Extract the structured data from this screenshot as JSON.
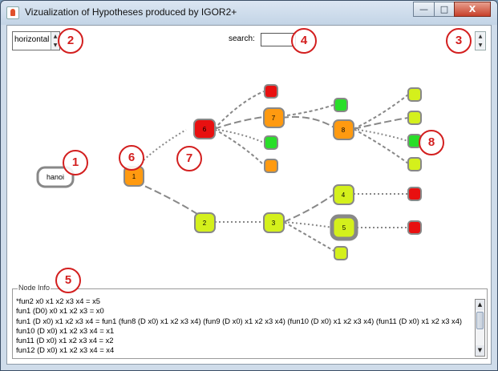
{
  "window": {
    "title": "Vizualization of Hypotheses produced by IGOR2+",
    "buttons": {
      "minimize": "—",
      "maximize": "□",
      "close": "X"
    }
  },
  "controls": {
    "orientation_value": "horizontal",
    "search_label": "search:",
    "search_value": ""
  },
  "colors": {
    "red": "#e81010",
    "orange": "#ff9a10",
    "lime": "#d4f01c",
    "green": "#29de29",
    "badge": "#d31f1f"
  },
  "graph": {
    "root_label": "hanoi",
    "nodes": [
      {
        "id": "n1",
        "label": "1",
        "color": "orange"
      },
      {
        "id": "n6",
        "label": "6",
        "color": "red"
      },
      {
        "id": "n2",
        "label": "2",
        "color": "lime"
      },
      {
        "id": "n7",
        "label": "7",
        "color": "orange"
      },
      {
        "id": "n8",
        "label": "8",
        "color": "orange"
      },
      {
        "id": "n3",
        "label": "3",
        "color": "lime"
      },
      {
        "id": "n4",
        "label": "4",
        "color": "lime"
      },
      {
        "id": "n5",
        "label": "5",
        "color": "lime"
      }
    ],
    "leaf_nodes": [
      {
        "id": "l1",
        "color": "red"
      },
      {
        "id": "l2",
        "color": "green"
      },
      {
        "id": "l3",
        "color": "orange"
      },
      {
        "id": "l4",
        "color": "green"
      },
      {
        "id": "l5",
        "color": "lime"
      },
      {
        "id": "l6",
        "color": "lime"
      },
      {
        "id": "l7",
        "color": "green"
      },
      {
        "id": "l8",
        "color": "lime"
      },
      {
        "id": "l9",
        "color": "red"
      },
      {
        "id": "l10",
        "color": "red"
      },
      {
        "id": "l11",
        "color": "lime"
      }
    ]
  },
  "annotations": [
    "1",
    "2",
    "3",
    "4",
    "5",
    "6",
    "7",
    "8"
  ],
  "node_info": {
    "title": "Node Info",
    "lines": [
      "*fun2 x0 x1 x2 x3 x4 = x5",
      "fun1 (D0) x0 x1 x2 x3 = x0",
      "fun1 (D x0) x1 x2 x3 x4 = fun1 (fun8 (D x0) x1 x2 x3 x4) (fun9 (D x0) x1 x2 x3 x4) (fun10 (D x0) x1 x2 x3 x4) (fun11 (D x0) x1 x2 x3 x4)",
      "fun10 (D x0) x1 x2 x3 x4 = x1",
      "fun11 (D x0) x1 x2 x3 x4 = x2",
      "fun12 (D x0) x1 x2 x3 x4 = x4"
    ]
  }
}
